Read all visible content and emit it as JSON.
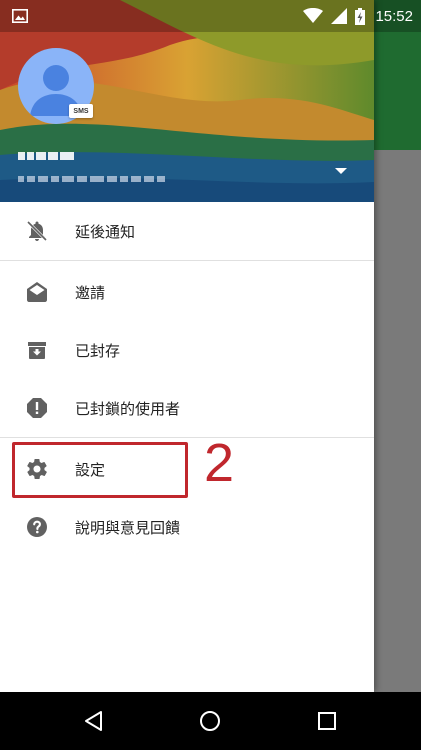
{
  "status_bar": {
    "time": "15:52",
    "icons": [
      "image-icon",
      "wifi-icon",
      "signal-icon",
      "battery-charging-icon"
    ]
  },
  "account": {
    "badge": "SMS"
  },
  "menu": {
    "items": [
      {
        "label": "延後通知",
        "icon": "snooze-bell-icon"
      },
      {
        "label": "邀請",
        "icon": "open-mail-icon"
      },
      {
        "label": "已封存",
        "icon": "archive-icon"
      },
      {
        "label": "已封鎖的使用者",
        "icon": "blocked-icon"
      },
      {
        "label": "設定",
        "icon": "gear-icon"
      },
      {
        "label": "說明與意見回饋",
        "icon": "help-icon"
      }
    ]
  },
  "annotation": {
    "step": "2",
    "color": "#c0272d"
  },
  "nav_bar": {
    "buttons": [
      "back-icon",
      "home-icon",
      "recents-icon"
    ]
  }
}
